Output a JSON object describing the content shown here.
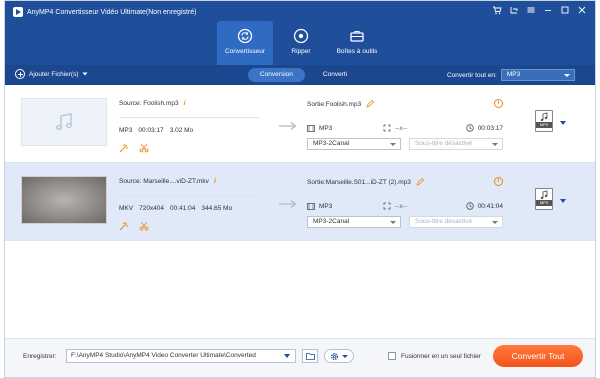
{
  "app": {
    "title": "AnyMP4 Convertisseur Vidéo Ultimate(Non enregistré)"
  },
  "nav": {
    "items": [
      {
        "label": "Convertisseur",
        "icon": "convert-icon",
        "active": true
      },
      {
        "label": "Ripper",
        "icon": "disc-icon",
        "active": false
      },
      {
        "label": "Boîtes à outils",
        "icon": "toolbox-icon",
        "active": false
      }
    ]
  },
  "toolbar": {
    "add_files_label": "Ajouter Fichier(s)",
    "tabs": [
      {
        "label": "Conversion",
        "active": true
      },
      {
        "label": "Converti",
        "active": false
      }
    ],
    "convert_all_label": "Convertir tout en:",
    "convert_all_value": "MP3"
  },
  "files": [
    {
      "source": "Source: Foolish.mp3",
      "format": "MP3",
      "duration": "00:03:17",
      "size": "3.02 Mo",
      "resolution": "",
      "output": "Sortie:Foolish.mp3",
      "out_format": "MP3",
      "out_resolution": "--x--",
      "out_duration": "00:03:17",
      "audio_track": "MP3-2Canal",
      "subtitle": "Sous-titre désactivé",
      "format_badge": "MP3",
      "selected": false
    },
    {
      "source": "Source: Marseille....viD-ZT.mkv",
      "format": "MKV",
      "duration": "00:41:04",
      "size": "344.65 Mo",
      "resolution": "720x404",
      "output": "Sortie:Marseille.S01...iD-ZT (2).mp3",
      "out_format": "MP3",
      "out_resolution": "--x--",
      "out_duration": "00:41:04",
      "audio_track": "MP3-2Canal",
      "subtitle": "Sous-titre désactivé",
      "format_badge": "MP3",
      "selected": true
    }
  ],
  "footer": {
    "save_label": "Enregistrer:",
    "save_path": "F:\\AnyMP4 Studio\\AnyMP4 Video Converter Ultimate\\Converted",
    "merge_label": "Fusionner en un seul fichier",
    "convert_all_button": "Convertir Tout"
  },
  "colors": {
    "header": "#1f4f9b",
    "toolbar": "#1a478d",
    "accent_orange": "#f2541b",
    "selected_row": "#dfe9f7"
  }
}
